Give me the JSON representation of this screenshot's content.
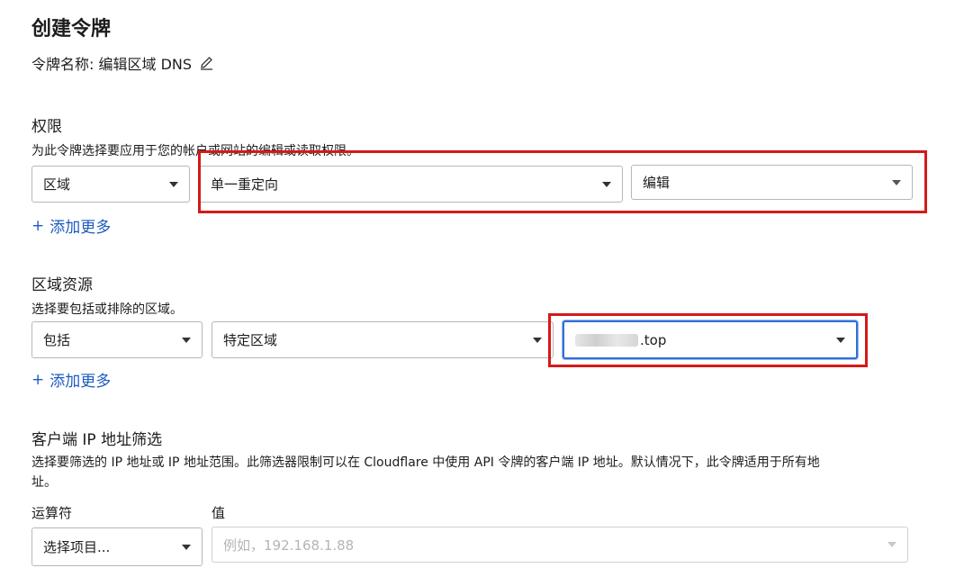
{
  "header": {
    "title": "创建令牌",
    "token_name": "令牌名称: 编辑区域 DNS"
  },
  "permissions": {
    "title": "权限",
    "description": "为此令牌选择要应用于您的帐户或网站的编辑或读取权限。",
    "scope_select": "区域",
    "resource_select": "单一重定向",
    "access_select": "编辑",
    "add_more": "添加更多"
  },
  "zone_resources": {
    "title": "区域资源",
    "description": "选择要包括或排除的区域。",
    "include_select": "包括",
    "type_select": "特定区域",
    "zone_select": ".top",
    "add_more": "添加更多"
  },
  "ip_filter": {
    "title": "客户端 IP 地址筛选",
    "description": "选择要筛选的 IP 地址或 IP 地址范围。此筛选器限制可以在 Cloudflare 中使用 API 令牌的客户端 IP 地址。默认情况下，此令牌适用于所有地址。",
    "description_line1": "选择要筛选的 IP 地址或 IP 地址范围。此筛选器限制可以在 Cloudflare 中使用 API 令牌的客户端 IP 地址。默认情况下，此令牌适用于所有地",
    "description_line2": "址。",
    "operator_label": "运算符",
    "value_label": "值",
    "operator_select": "选择项目...",
    "value_placeholder": "例如，192.168.1.88"
  },
  "icons": {
    "pencil": "pencil-icon",
    "plus": "plus-icon",
    "caret": "chevron-down-icon"
  },
  "colors": {
    "link": "#1e5bbf",
    "highlight": "#d51919",
    "focus": "#2f6fdb"
  }
}
